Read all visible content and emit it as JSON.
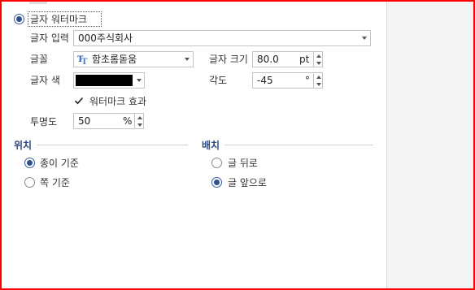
{
  "watermark": {
    "option_label": "글자 워터마크",
    "selected": true
  },
  "text_input": {
    "label": "글자 입력",
    "value": "000주식회사"
  },
  "font": {
    "label": "글꼴",
    "value": "함초롬돋움",
    "icon": "truetype-font-icon"
  },
  "font_size": {
    "label": "글자 크기",
    "value": "80.0",
    "unit": "pt"
  },
  "text_color": {
    "label": "글자 색",
    "swatch_color": "#000000"
  },
  "angle": {
    "label": "각도",
    "value": "-45",
    "unit": "°"
  },
  "watermark_effect": {
    "label": "워터마크 효과",
    "checked": true
  },
  "transparency": {
    "label": "투명도",
    "value": "50",
    "unit": "%"
  },
  "position": {
    "title": "위치",
    "options": [
      {
        "label": "종이 기준",
        "selected": true
      },
      {
        "label": "쪽 기준",
        "selected": false
      }
    ]
  },
  "placement": {
    "title": "배치",
    "options": [
      {
        "label": "글 뒤로",
        "selected": false
      },
      {
        "label": "글 앞으로",
        "selected": true
      }
    ]
  },
  "colors": {
    "accent": "#2f4f8f",
    "section_title": "#2e4a80",
    "frame_border": "#ff0000"
  }
}
